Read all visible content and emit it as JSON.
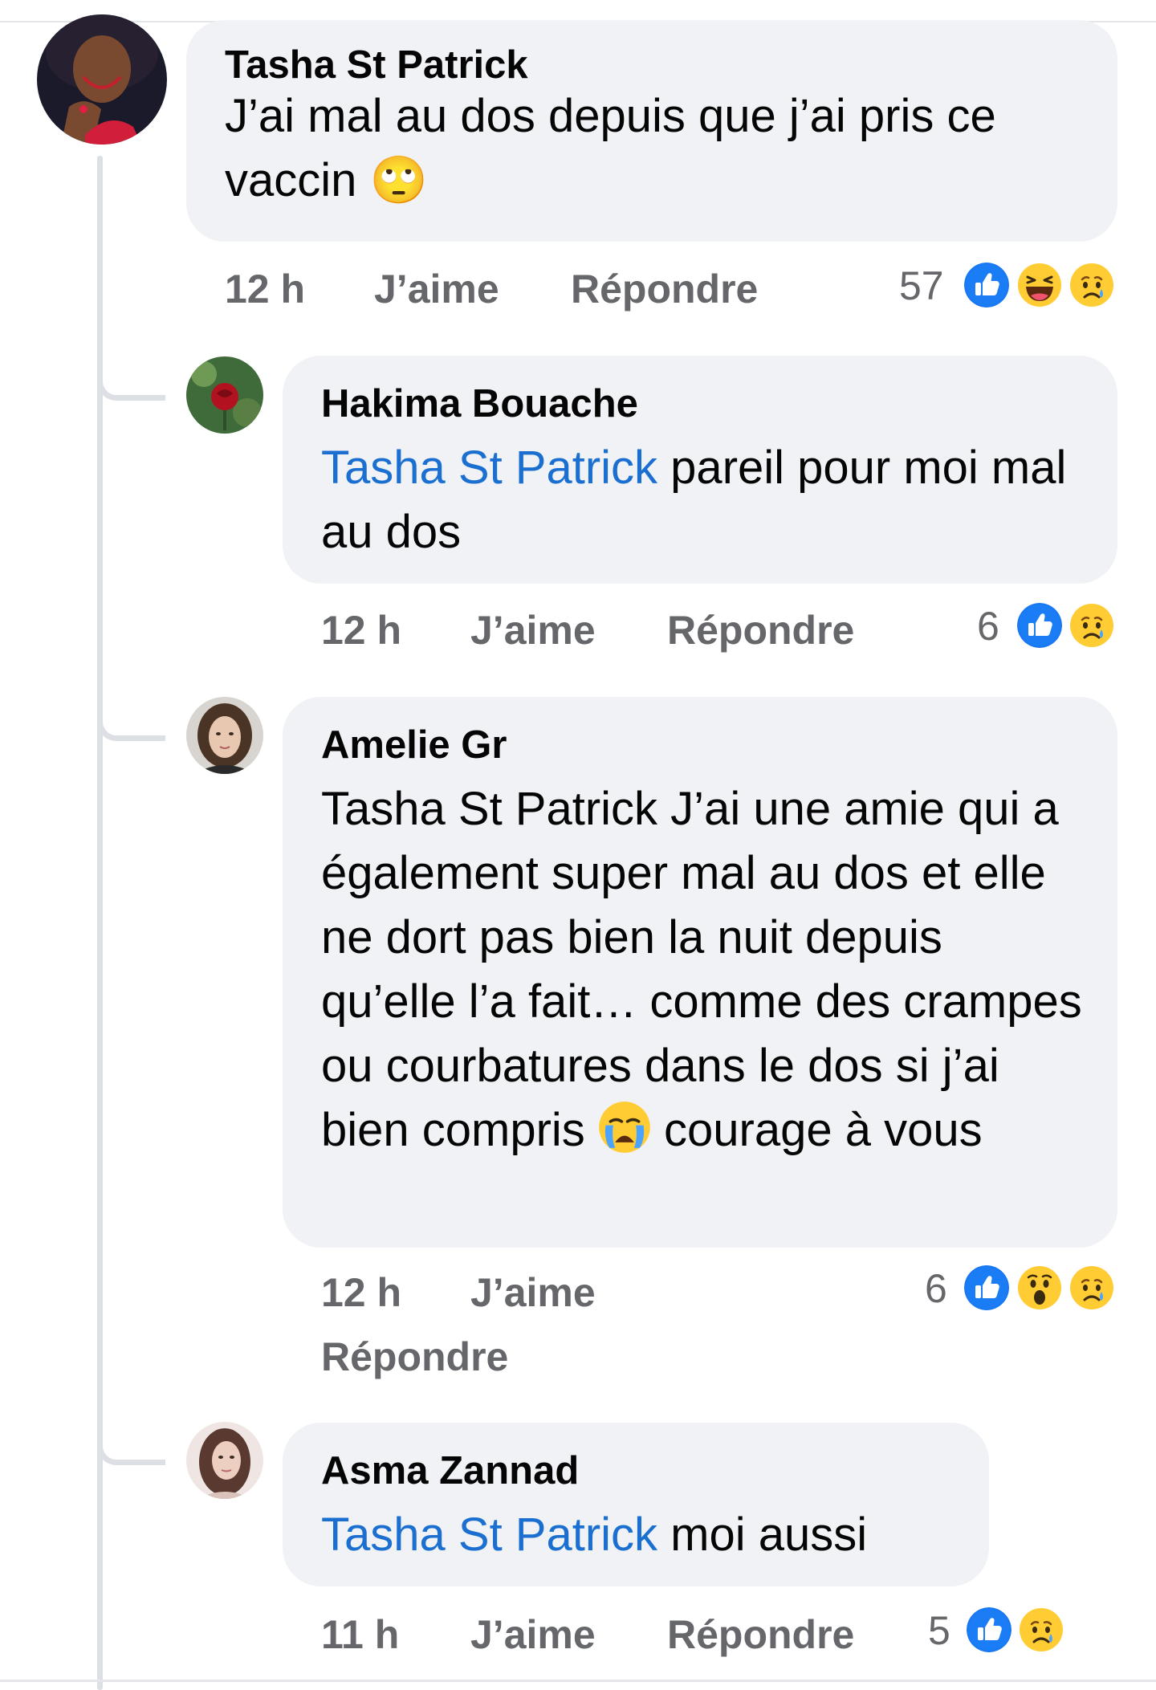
{
  "comments": [
    {
      "author": "Tasha St Patrick",
      "text": "J’ai mal au dos depuis que j’ai pris ce vaccin 🙄",
      "time": "12 h",
      "like_label": "J’aime",
      "reply_label": "Répondre",
      "reaction_count": "57",
      "reactions": [
        "like-icon",
        "haha-icon",
        "sad-icon"
      ]
    },
    {
      "author": "Hakima Bouache",
      "mention": "Tasha St Patrick",
      "text": " pareil pour moi mal au dos",
      "time": "12 h",
      "like_label": "J’aime",
      "reply_label": "Répondre",
      "reaction_count": "6",
      "reactions": [
        "like-icon",
        "sad-icon"
      ]
    },
    {
      "author": "Amelie Gr",
      "text_before": "Tasha St Patrick J’ai une amie qui a également super mal au dos et elle ne dort pas bien la nuit depuis qu’elle l’a fait… comme des crampes ou courbatures dans le dos si j’ai bien compris ",
      "text_after": " courage à vous",
      "inline_emoji": "crying-face-emoji",
      "time": "12 h",
      "like_label": "J’aime",
      "reply_label": "Répondre",
      "reaction_count": "6",
      "reactions": [
        "like-icon",
        "wow-icon",
        "sad-icon"
      ]
    },
    {
      "author": "Asma Zannad",
      "mention": "Tasha St Patrick",
      "text": " moi aussi",
      "time": "11 h",
      "like_label": "J’aime",
      "reply_label": "Répondre",
      "reaction_count": "5",
      "reactions": [
        "like-icon",
        "sad-icon"
      ]
    }
  ],
  "colors": {
    "mention": "#1a6fd0",
    "bubble": "#f0f2f5",
    "meta": "#65676b",
    "like": "#1877f2",
    "emoji": "#ffcc33"
  }
}
